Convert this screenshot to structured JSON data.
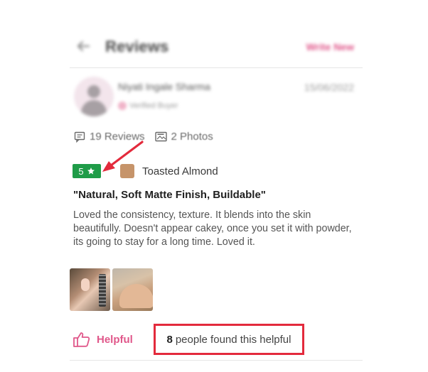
{
  "header": {
    "title": "Reviews",
    "write_new": "Write New"
  },
  "reviewer": {
    "name": "Niyati Ingale Sharma",
    "date": "15/06/2022",
    "verified": "Verified Buyer"
  },
  "stats": {
    "reviews": "19 Reviews",
    "photos": "2 Photos"
  },
  "review": {
    "rating": "5",
    "shade": "Toasted Almond",
    "title": "\"Natural, Soft Matte Finish, Buildable\"",
    "body": "Loved the consistency, texture. It blends into the skin beautifully. Doesn't appear cakey, once you set it with powder, its going to stay for a long time. Loved it."
  },
  "helpful": {
    "label": "Helpful",
    "count": "8",
    "count_text": "people found this helpful"
  },
  "colors": {
    "accent": "#e0578a",
    "rating_green": "#1f9c48",
    "annotation_red": "#e32a3c",
    "shade_swatch": "#c6946a"
  },
  "icons": [
    "back-arrow-icon",
    "comment-icon",
    "image-icon",
    "star-icon",
    "thumbs-up-icon",
    "verified-icon"
  ]
}
